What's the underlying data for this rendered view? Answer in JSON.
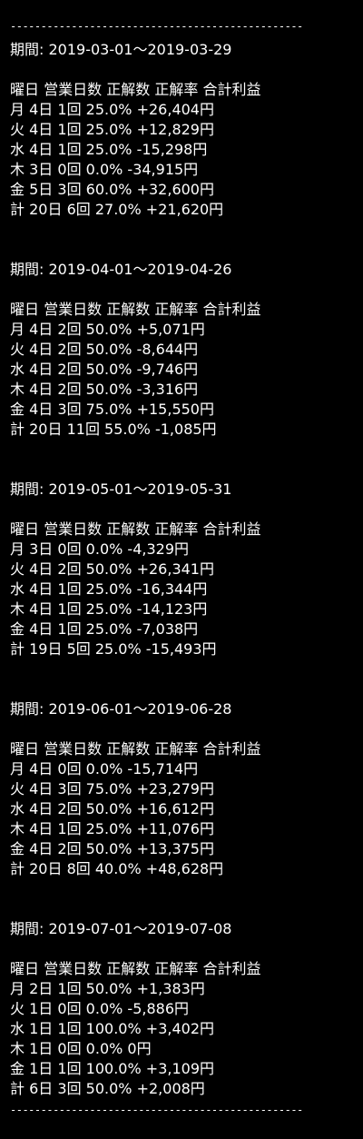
{
  "divider": "------------------------------------------------",
  "header": {
    "weekday": "曜日",
    "days": "営業日数",
    "correct": "正解数",
    "rate": "正解率",
    "profit": "合計利益"
  },
  "periods": [
    {
      "label": "期間: 2019-03-01〜2019-03-29",
      "rows": [
        {
          "weekday": "月",
          "days": "4日",
          "correct": "1回",
          "rate": "25.0%",
          "profit": "+26,404円"
        },
        {
          "weekday": "火",
          "days": "4日",
          "correct": "1回",
          "rate": "25.0%",
          "profit": "+12,829円"
        },
        {
          "weekday": "水",
          "days": "4日",
          "correct": "1回",
          "rate": "25.0%",
          "profit": "-15,298円"
        },
        {
          "weekday": "木",
          "days": "3日",
          "correct": "0回",
          "rate": "0.0%",
          "profit": "-34,915円"
        },
        {
          "weekday": "金",
          "days": "5日",
          "correct": "3回",
          "rate": "60.0%",
          "profit": "+32,600円"
        },
        {
          "weekday": "計",
          "days": "20日",
          "correct": "6回",
          "rate": "27.0%",
          "profit": "+21,620円"
        }
      ]
    },
    {
      "label": "期間: 2019-04-01〜2019-04-26",
      "rows": [
        {
          "weekday": "月",
          "days": "4日",
          "correct": "2回",
          "rate": "50.0%",
          "profit": "+5,071円"
        },
        {
          "weekday": "火",
          "days": "4日",
          "correct": "2回",
          "rate": "50.0%",
          "profit": "-8,644円"
        },
        {
          "weekday": "水",
          "days": "4日",
          "correct": "2回",
          "rate": "50.0%",
          "profit": "-9,746円"
        },
        {
          "weekday": "木",
          "days": "4日",
          "correct": "2回",
          "rate": "50.0%",
          "profit": "-3,316円"
        },
        {
          "weekday": "金",
          "days": "4日",
          "correct": "3回",
          "rate": "75.0%",
          "profit": "+15,550円"
        },
        {
          "weekday": "計",
          "days": "20日",
          "correct": "11回",
          "rate": "55.0%",
          "profit": "-1,085円"
        }
      ]
    },
    {
      "label": "期間: 2019-05-01〜2019-05-31",
      "rows": [
        {
          "weekday": "月",
          "days": "3日",
          "correct": "0回",
          "rate": "0.0%",
          "profit": "-4,329円"
        },
        {
          "weekday": "火",
          "days": "4日",
          "correct": "2回",
          "rate": "50.0%",
          "profit": "+26,341円"
        },
        {
          "weekday": "水",
          "days": "4日",
          "correct": "1回",
          "rate": "25.0%",
          "profit": "-16,344円"
        },
        {
          "weekday": "木",
          "days": "4日",
          "correct": "1回",
          "rate": "25.0%",
          "profit": "-14,123円"
        },
        {
          "weekday": "金",
          "days": "4日",
          "correct": "1回",
          "rate": "25.0%",
          "profit": "-7,038円"
        },
        {
          "weekday": "計",
          "days": "19日",
          "correct": "5回",
          "rate": "25.0%",
          "profit": "-15,493円"
        }
      ]
    },
    {
      "label": "期間: 2019-06-01〜2019-06-28",
      "rows": [
        {
          "weekday": "月",
          "days": "4日",
          "correct": "0回",
          "rate": "0.0%",
          "profit": "-15,714円"
        },
        {
          "weekday": "火",
          "days": "4日",
          "correct": "3回",
          "rate": "75.0%",
          "profit": "+23,279円"
        },
        {
          "weekday": "水",
          "days": "4日",
          "correct": "2回",
          "rate": "50.0%",
          "profit": "+16,612円"
        },
        {
          "weekday": "木",
          "days": "4日",
          "correct": "1回",
          "rate": "25.0%",
          "profit": "+11,076円"
        },
        {
          "weekday": "金",
          "days": "4日",
          "correct": "2回",
          "rate": "50.0%",
          "profit": "+13,375円"
        },
        {
          "weekday": "計",
          "days": "20日",
          "correct": "8回",
          "rate": "40.0%",
          "profit": "+48,628円"
        }
      ]
    },
    {
      "label": "期間: 2019-07-01〜2019-07-08",
      "rows": [
        {
          "weekday": "月",
          "days": "2日",
          "correct": "1回",
          "rate": "50.0%",
          "profit": "+1,383円"
        },
        {
          "weekday": "火",
          "days": "1日",
          "correct": "0回",
          "rate": "0.0%",
          "profit": "-5,886円"
        },
        {
          "weekday": "水",
          "days": "1日",
          "correct": "1回",
          "rate": "100.0%",
          "profit": "+3,402円"
        },
        {
          "weekday": "木",
          "days": "1日",
          "correct": "0回",
          "rate": "0.0%",
          "profit": "0円"
        },
        {
          "weekday": "金",
          "days": "1日",
          "correct": "1回",
          "rate": "100.0%",
          "profit": "+3,109円"
        },
        {
          "weekday": "計",
          "days": "6日",
          "correct": "3回",
          "rate": "50.0%",
          "profit": "+2,008円"
        }
      ]
    }
  ]
}
